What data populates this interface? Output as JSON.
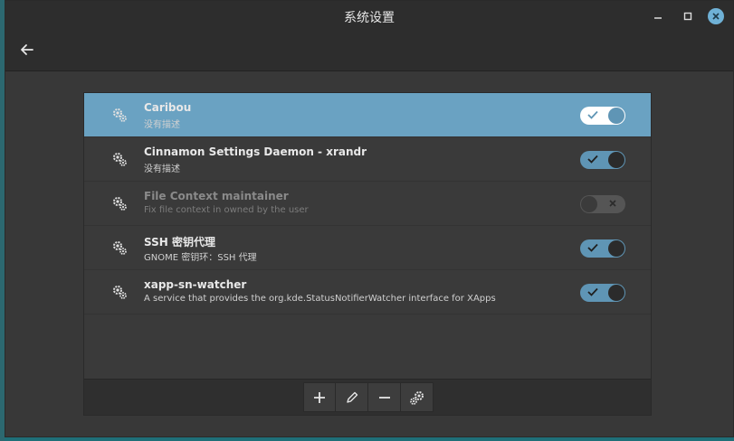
{
  "window": {
    "title": "系统设置"
  },
  "rows": [
    {
      "name": "Caribou",
      "desc": "没有描述",
      "enabled": true,
      "selected": true,
      "dim": false
    },
    {
      "name": "Cinnamon Settings Daemon - xrandr",
      "desc": "没有描述",
      "enabled": true,
      "selected": false,
      "dim": false
    },
    {
      "name": "File Context maintainer",
      "desc": "Fix file context in owned by the user",
      "enabled": false,
      "selected": false,
      "dim": true
    },
    {
      "name": "SSH 密钥代理",
      "desc": "GNOME 密钥环：SSH 代理",
      "enabled": true,
      "selected": false,
      "dim": false
    },
    {
      "name": "xapp-sn-watcher",
      "desc": "A service that provides the org.kde.StatusNotifierWatcher interface for XApps",
      "enabled": true,
      "selected": false,
      "dim": false
    }
  ],
  "icons": {
    "back": "back-arrow-icon",
    "minimize": "minimize-icon",
    "maximize": "maximize-icon",
    "close": "close-icon",
    "gear": "gear-icon",
    "add": "plus-icon",
    "edit": "pencil-icon",
    "remove": "minus-icon",
    "settings": "settings-gears-icon"
  },
  "colors": {
    "selected_row": "#6aa2c2",
    "toggle_on": "#5f95b5",
    "toggle_off": "#555555"
  }
}
